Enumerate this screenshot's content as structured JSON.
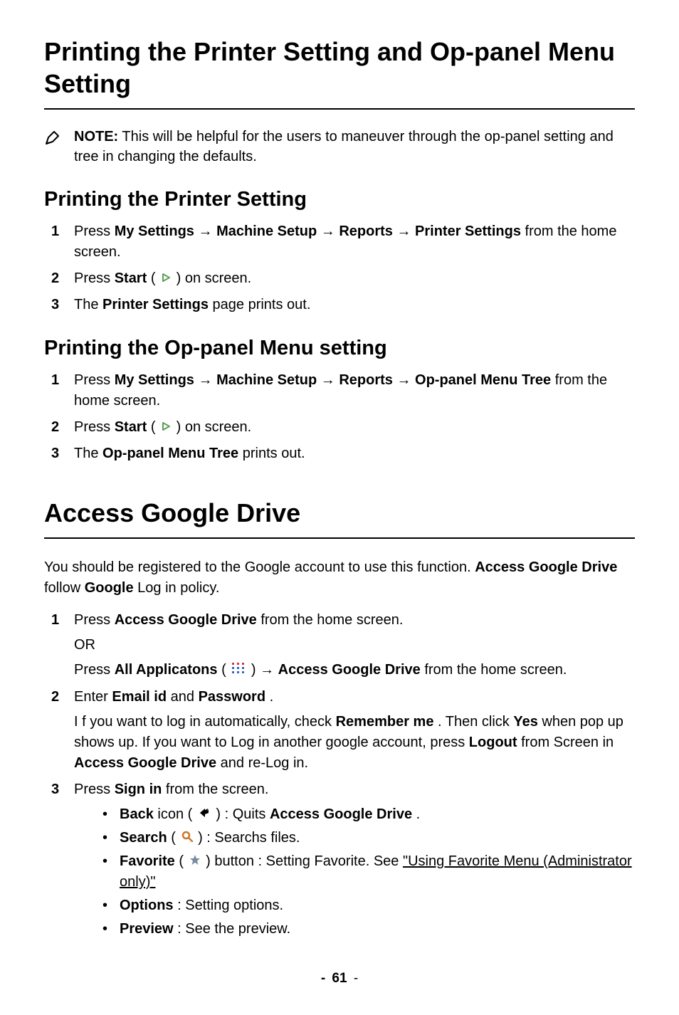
{
  "heading1": "Printing the Printer Setting and Op-panel Menu Setting",
  "note": {
    "label": "NOTE:",
    "text": "This will be helpful for the users to maneuver through the op-panel setting and tree in changing the defaults."
  },
  "section1": {
    "heading": "Printing the Printer Setting",
    "step1": {
      "press": "Press ",
      "my_settings": "My Settings",
      "machine_setup": "Machine Setup",
      "reports": "Reports",
      "printer_settings": "Printer Settings",
      "tail": " from the home screen."
    },
    "step2": {
      "press": "Press ",
      "start": "Start",
      "paren_open": " (",
      "paren_close": ") on screen."
    },
    "step3": {
      "the": "The ",
      "printer_settings": "Printer Settings",
      "tail": " page prints out."
    }
  },
  "section2": {
    "heading": "Printing the Op-panel Menu setting",
    "step1": {
      "press": "Press ",
      "my_settings": "My Settings",
      "machine_setup": "Machine Setup",
      "reports": "Reports",
      "op_panel": "Op-panel Menu Tree",
      "tail": " from the home screen."
    },
    "step2": {
      "press": "Press ",
      "start": "Start",
      "paren_open": " (",
      "paren_close": ") on screen."
    },
    "step3": {
      "the": "The ",
      "op_panel": "Op-panel Menu Tree",
      "tail": " prints out."
    }
  },
  "heading2": "Access Google Drive",
  "gd_intro": {
    "p1a": "You should be registered to the Google account to use this function. ",
    "p1b": "Access Google Drive",
    "p1c": " follow ",
    "p1d": "Google",
    "p1e": " Log in policy."
  },
  "gd_steps": {
    "s1": {
      "press": "Press ",
      "agd": "Access Google Drive",
      "tail": " from the home screen.",
      "or": "OR",
      "press2": "Press ",
      "all_app": "All Applicatons",
      "paren_open": " (",
      "paren_close": " ) ",
      "agd2": " Access Google Drive",
      "tail2": " from the home screen."
    },
    "s2": {
      "enter": "Enter ",
      "email": "Email id",
      "and": " and ",
      "password": "Password",
      "dot": ".",
      "p2a": "I f you want to log in automatically, check ",
      "remember": "Remember me",
      "p2b": ". Then click ",
      "yes": "Yes",
      "p2c": " when pop up shows up. If you want to Log in another google account, press ",
      "logout": "Logout",
      "p2d": " from Screen in ",
      "agd": "Access Google Drive",
      "p2e": " and re-Log in."
    },
    "s3": {
      "press": "Press ",
      "signin": "Sign in",
      "tail": " from the screen.",
      "b1": {
        "back": "Back",
        "icon": " icon (",
        "close": ") : Quits ",
        "agd": "Access Google Drive",
        "dot": "."
      },
      "b2": {
        "search": "Search",
        "open": " ( ",
        "close": " ) : Searchs files."
      },
      "b3": {
        "fav": "Favorite",
        "open": " ( ",
        "close": ") button : Setting Favorite. See ",
        "link": "\"Using Favorite Menu (Administrator only)\""
      },
      "b4": {
        "options": "Options",
        "tail": " : Setting options."
      },
      "b5": {
        "preview": "Preview",
        "tail": " : See the preview."
      }
    }
  },
  "page_num": "61",
  "arrow": "→"
}
